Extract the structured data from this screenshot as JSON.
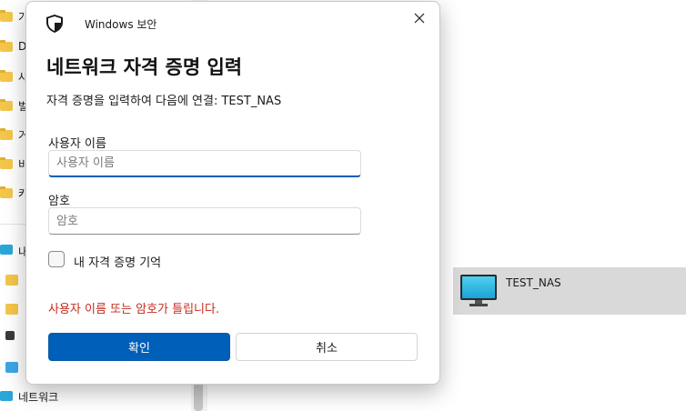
{
  "explorer": {
    "sidebar_items": [
      {
        "label": "가",
        "icon": "folder-icon"
      },
      {
        "label": "D",
        "icon": "folder-icon"
      },
      {
        "label": "사",
        "icon": "folder-icon"
      },
      {
        "label": "벌",
        "icon": "folder-icon"
      },
      {
        "label": "거",
        "icon": "folder-icon"
      },
      {
        "label": "비",
        "icon": "folder-icon"
      },
      {
        "label": "캬",
        "icon": "folder-icon"
      }
    ],
    "pc_item": {
      "label": "내",
      "icon": "pc-icon"
    },
    "network_item": {
      "label": "네트워크",
      "icon": "network-icon"
    },
    "network_device": {
      "label": "TEST_NAS",
      "icon": "monitor-icon"
    }
  },
  "dialog": {
    "title": "Windows 보안",
    "heading": "네트워크 자격 증명 입력",
    "subheading": "자격 증명을 입력하여 다음에 연결: TEST_NAS",
    "username_label": "사용자 이름",
    "username_placeholder": "사용자 이름",
    "username_value": "",
    "password_label": "암호",
    "password_placeholder": "암호",
    "password_value": "",
    "remember_label": "내 자격 증명 기억",
    "remember_checked": false,
    "error": "사용자 이름 또는 암호가 틀립니다.",
    "ok_label": "확인",
    "cancel_label": "취소"
  },
  "colors": {
    "accent": "#005fb8",
    "error": "#c42b1c",
    "folder": "#f4c64a"
  }
}
